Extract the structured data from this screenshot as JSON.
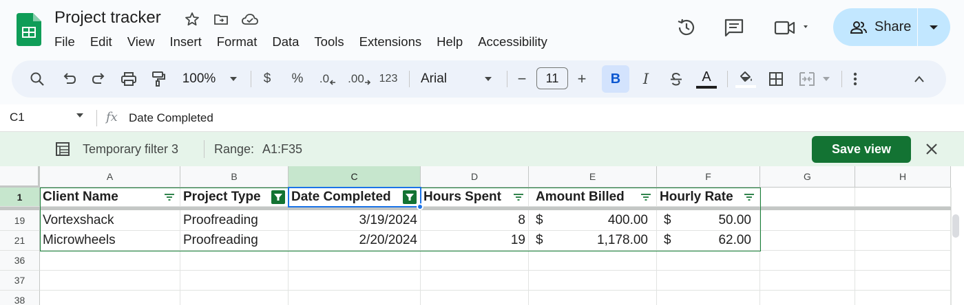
{
  "app": {
    "doc_title": "Project tracker",
    "menu": [
      "File",
      "Edit",
      "View",
      "Insert",
      "Format",
      "Data",
      "Tools",
      "Extensions",
      "Help",
      "Accessibility"
    ],
    "share_label": "Share"
  },
  "toolbar": {
    "zoom": "100%",
    "currency": "$",
    "percent": "%",
    "decrease_decimal": ".0",
    "increase_decimal": ".00",
    "number_format": "123",
    "font": "Arial",
    "font_size": "11",
    "minus": "−",
    "plus": "+",
    "bold": "B",
    "italic": "I",
    "text_color_letter": "A"
  },
  "formula_bar": {
    "cell_ref": "C1",
    "fx": "fx",
    "value": "Date Completed"
  },
  "filter_bar": {
    "name": "Temporary filter 3",
    "range_label": "Range:",
    "range_value": "A1:F35",
    "save_label": "Save view"
  },
  "sheet": {
    "column_letters": [
      "A",
      "B",
      "C",
      "D",
      "E",
      "F",
      "G",
      "H"
    ],
    "header_row_number": "1",
    "headers": [
      "Client Name",
      "Project Type",
      "Date Completed",
      "Hours Spent",
      "Amount Billed",
      "Hourly Rate"
    ],
    "rows": [
      {
        "row_number": "19",
        "client": "Vortexshack",
        "type": "Proofreading",
        "date": "3/19/2024",
        "hours": "8",
        "amount_symbol": "$",
        "amount": "400.00",
        "rate_symbol": "$",
        "rate": "50.00"
      },
      {
        "row_number": "21",
        "client": "Microwheels",
        "type": "Proofreading",
        "date": "2/20/2024",
        "hours": "19",
        "amount_symbol": "$",
        "amount": "1,178.00",
        "rate_symbol": "$",
        "rate": "62.00"
      }
    ],
    "empty_rows": [
      "36",
      "37",
      "38"
    ]
  },
  "colors": {
    "accent": "#1a73e8",
    "save_button": "#137333",
    "filter_bar_bg": "#e6f4ea",
    "share_bg": "#c2e7ff"
  }
}
